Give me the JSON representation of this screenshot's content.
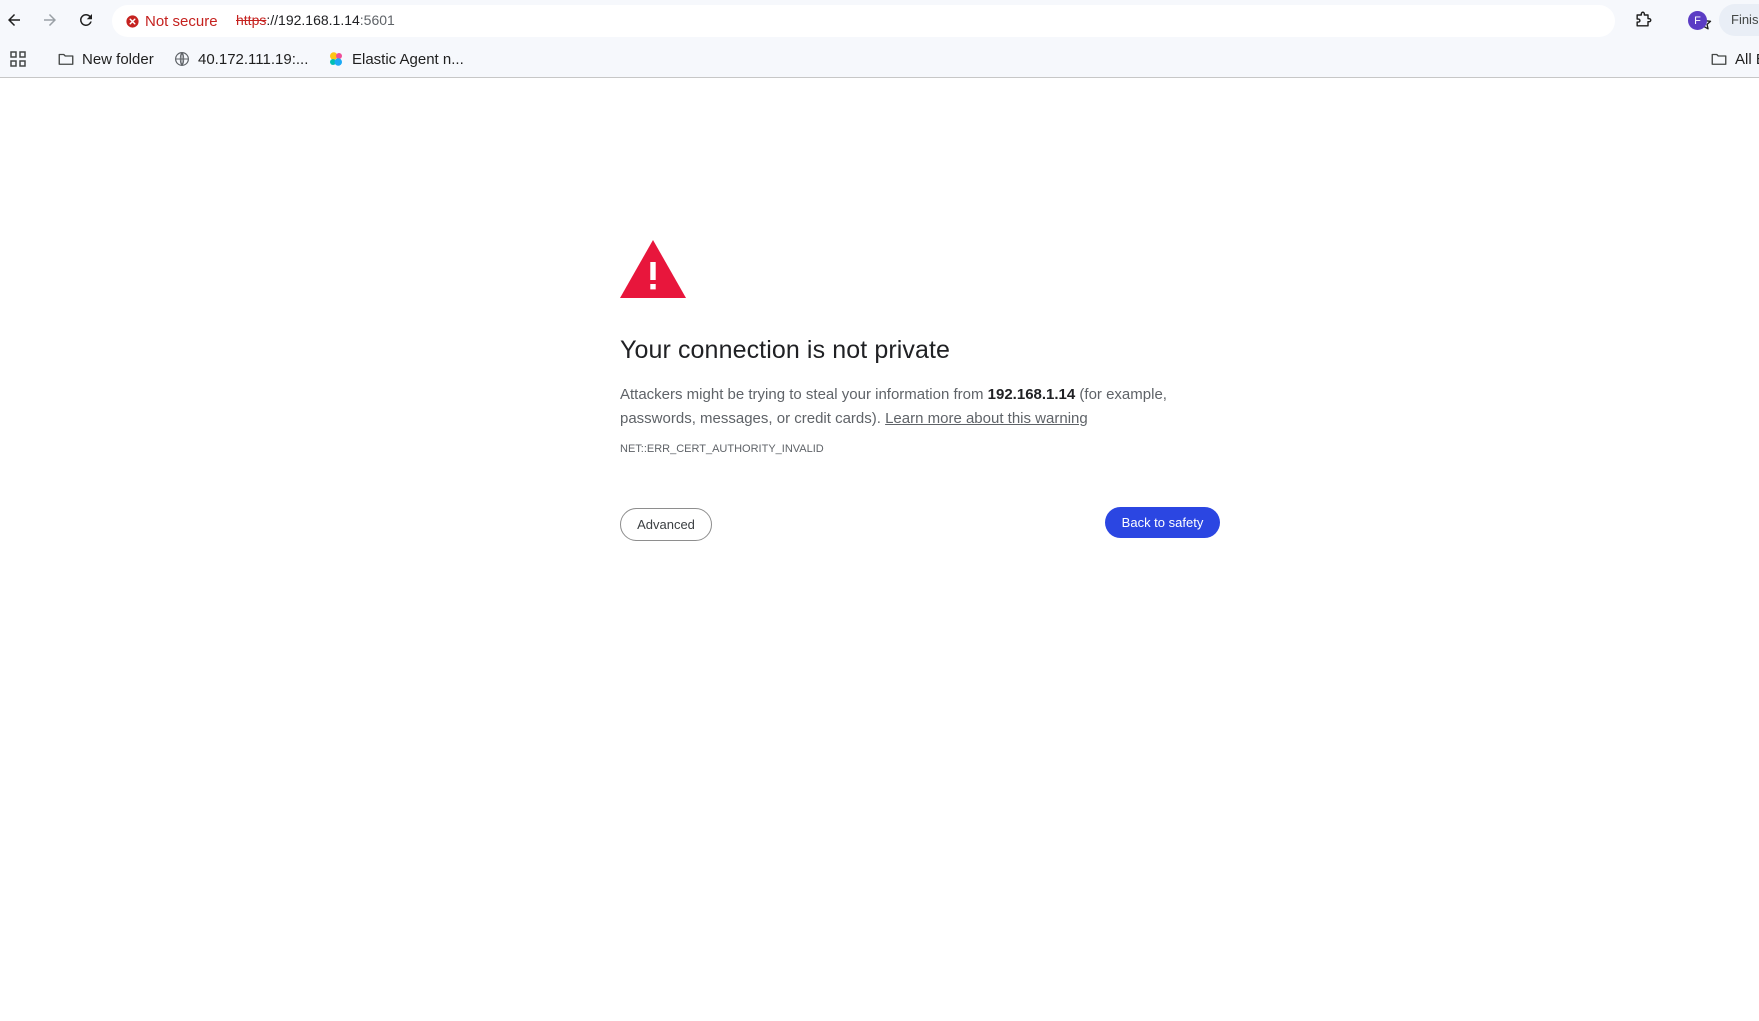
{
  "toolbar": {
    "back_icon": "arrow-left-icon",
    "forward_icon": "arrow-right-icon",
    "reload_icon": "reload-icon",
    "security_label": "Not secure",
    "url_scheme": "https",
    "url_separator": "://",
    "url_host": "192.168.1.14",
    "url_port": ":5601",
    "bookmark_star_icon": "star-outline-icon",
    "extensions_icon": "puzzle-icon",
    "profile_initial": "F",
    "profile_chip_label": "Finish update"
  },
  "bookmarks": {
    "items": [
      {
        "label": "New folder",
        "icon": "folder-icon"
      },
      {
        "label": "40.172.111.19:...",
        "icon": "globe-icon"
      },
      {
        "label": "Elastic Agent n...",
        "icon": "elastic-logo-icon"
      }
    ],
    "all_bookmarks_label": "All Bookmarks"
  },
  "interstitial": {
    "heading": "Your connection is not private",
    "body_prefix": "Attackers might be trying to steal your information from ",
    "body_host": "192.168.1.14",
    "body_suffix": " (for example, passwords, messages, or credit cards). ",
    "learn_more_link": "Learn more about this warning",
    "error_code": "NET::ERR_CERT_AUTHORITY_INVALID",
    "advanced_button": "Advanced",
    "back_button": "Back to safety"
  },
  "colors": {
    "danger_red": "#e8163c",
    "primary_blue": "#2b46e2",
    "chrome_bg": "#f6f8fc"
  }
}
